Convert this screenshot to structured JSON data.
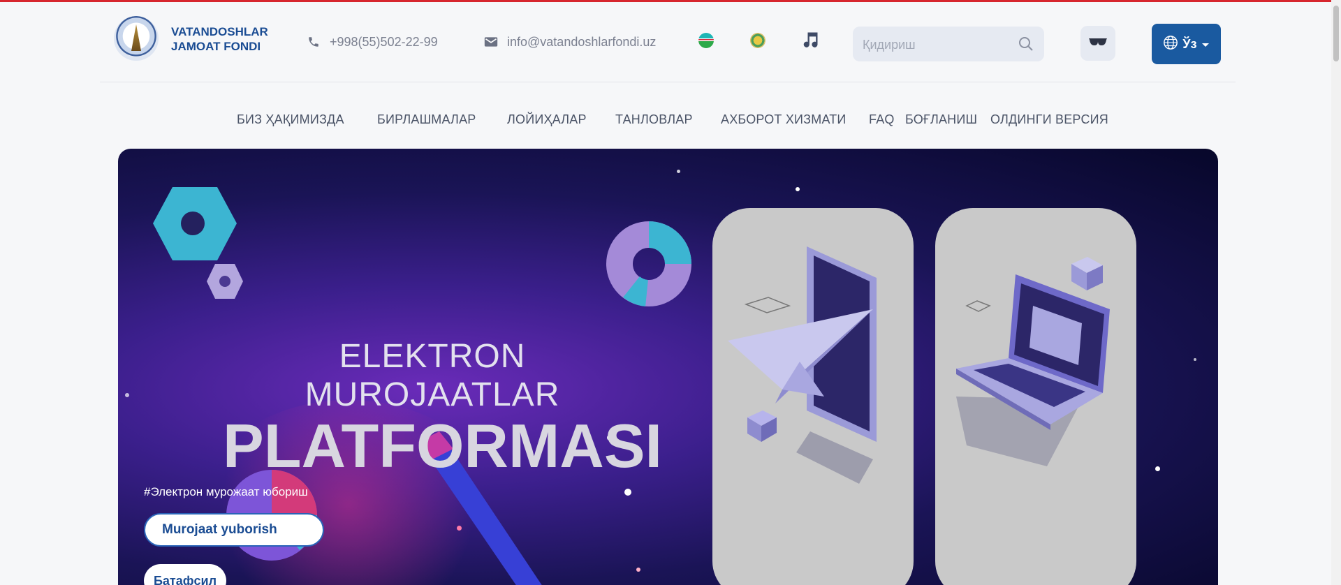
{
  "header": {
    "org_name_line1": "VATANDOSHLAR",
    "org_name_line2": "JAMOAT FONDI",
    "phone": "+998(55)502-22-99",
    "email": "info@vatandoshlarfondi.uz",
    "search_placeholder": "Қидириш",
    "language_label": "Ўз",
    "icons": [
      "logo",
      "phone-icon",
      "mail-icon",
      "uz-flag-icon",
      "uz-emblem-icon",
      "music-note-icon",
      "search-icon",
      "glasses-icon",
      "globe-icon",
      "caret-down-icon"
    ]
  },
  "nav": {
    "items": [
      "БИЗ ҲАҚИМИЗДА",
      "БИРЛАШМАЛАР",
      "ЛОЙИҲАЛАР",
      "ТАНЛОВЛАР",
      "АХБОРОТ ХИЗМАТИ",
      "FAQ",
      "БОҒЛАНИШ",
      "ОЛДИНГИ ВЕРСИЯ"
    ]
  },
  "hero": {
    "title_line1": "ELEKTRON MUROJAATLAR",
    "title_line2": "PLATFORMASI",
    "hashtag": "#Электрон мурожаат юбориш",
    "primary_button": "Murojaat yuborish",
    "secondary_button": "Батафсил"
  },
  "colors": {
    "accent": "#1a5aa0",
    "top_line": "#d7262e",
    "brand_text": "#1a4c93",
    "nav_text": "#4b5467"
  }
}
